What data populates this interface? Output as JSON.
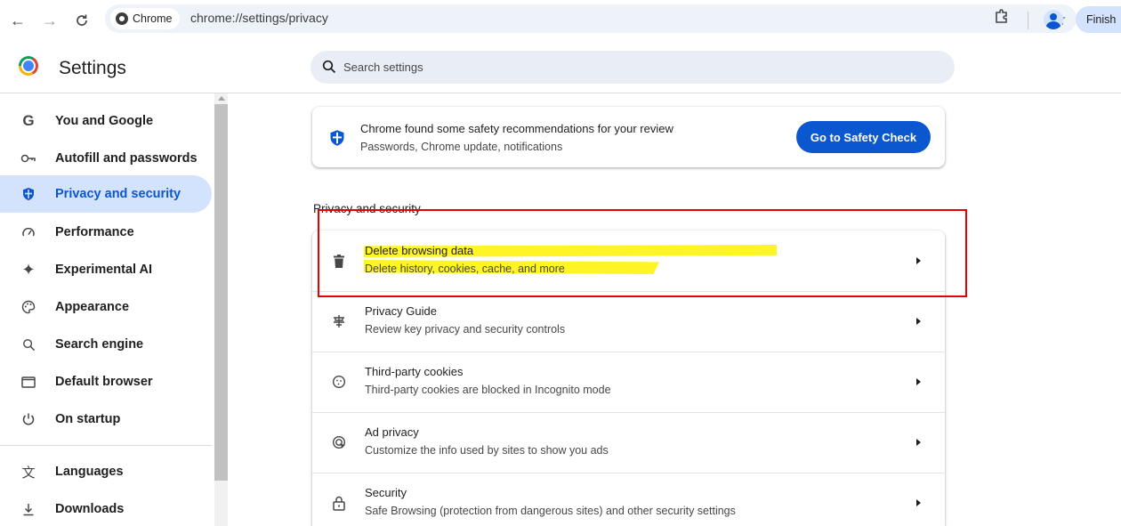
{
  "browser": {
    "chip_label": "Chrome",
    "url": "chrome://settings/privacy",
    "profile_button": "Finish"
  },
  "header": {
    "title": "Settings",
    "search_placeholder": "Search settings"
  },
  "sidebar": {
    "active_color": "#0b57d0",
    "items": [
      {
        "label": "You and Google",
        "icon": "google-g-icon"
      },
      {
        "label": "Autofill and passwords",
        "icon": "key-icon"
      },
      {
        "label": "Privacy and security",
        "icon": "shield-icon",
        "active": true
      },
      {
        "label": "Performance",
        "icon": "gauge-icon"
      },
      {
        "label": "Experimental AI",
        "icon": "sparkle-icon"
      },
      {
        "label": "Appearance",
        "icon": "palette-icon"
      },
      {
        "label": "Search engine",
        "icon": "search-icon"
      },
      {
        "label": "Default browser",
        "icon": "browser-window-icon"
      },
      {
        "label": "On startup",
        "icon": "power-icon"
      },
      {
        "label": "Languages",
        "icon": "translate-icon"
      },
      {
        "label": "Downloads",
        "icon": "download-icon"
      }
    ]
  },
  "safety_check": {
    "title": "Chrome found some safety recommendations for your review",
    "subtitle": "Passwords, Chrome update, notifications",
    "button": "Go to Safety Check",
    "button_color": "#0b57d0"
  },
  "privacy_section": {
    "title": "Privacy and security",
    "rows": [
      {
        "title": "Delete browsing data",
        "subtitle": "Delete history, cookies, cache, and more",
        "icon": "trash-icon",
        "highlighted": true
      },
      {
        "title": "Privacy Guide",
        "subtitle": "Review key privacy and security controls",
        "icon": "privacy-guide-icon"
      },
      {
        "title": "Third-party cookies",
        "subtitle": "Third-party cookies are blocked in Incognito mode",
        "icon": "cookie-icon"
      },
      {
        "title": "Ad privacy",
        "subtitle": "Customize the info used by sites to show you ads",
        "icon": "ad-privacy-icon"
      },
      {
        "title": "Security",
        "subtitle": "Safe Browsing (protection from dangerous sites) and other security settings",
        "icon": "lock-icon"
      }
    ]
  },
  "annotation": {
    "highlight_color": "#fff200",
    "box_color": "#e60000"
  }
}
